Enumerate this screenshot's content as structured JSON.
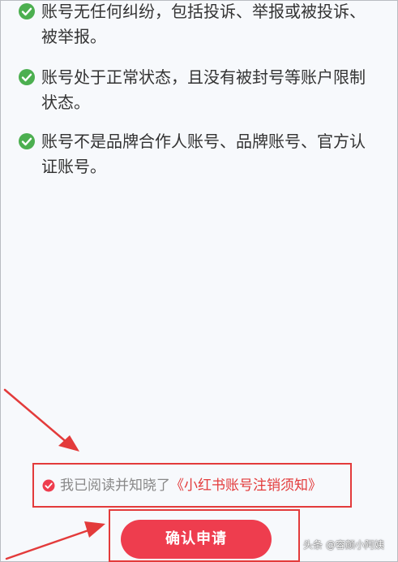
{
  "conditions": [
    {
      "icon": "check-circle-icon",
      "text": "账号无任何纠纷，包括投诉、举报或被投诉、被举报。"
    },
    {
      "icon": "check-circle-icon",
      "text": "账号处于正常状态，且没有被封号等账户限制状态。"
    },
    {
      "icon": "check-circle-icon",
      "text": "账号不是品牌合作人账号、品牌账号、官方认证账号。"
    }
  ],
  "agreement": {
    "checked": true,
    "prefix": "我已阅读并知晓了",
    "link_text": "《小红书账号注销须知》"
  },
  "confirm_button": {
    "label": "确认申请"
  },
  "watermark": {
    "text": "头条 @容颜小阿姨"
  },
  "colors": {
    "check_green": "#4caf50",
    "accent_red": "#ee3d4e",
    "annotation_red": "#e33b3b",
    "background": "#f7f9fc"
  }
}
